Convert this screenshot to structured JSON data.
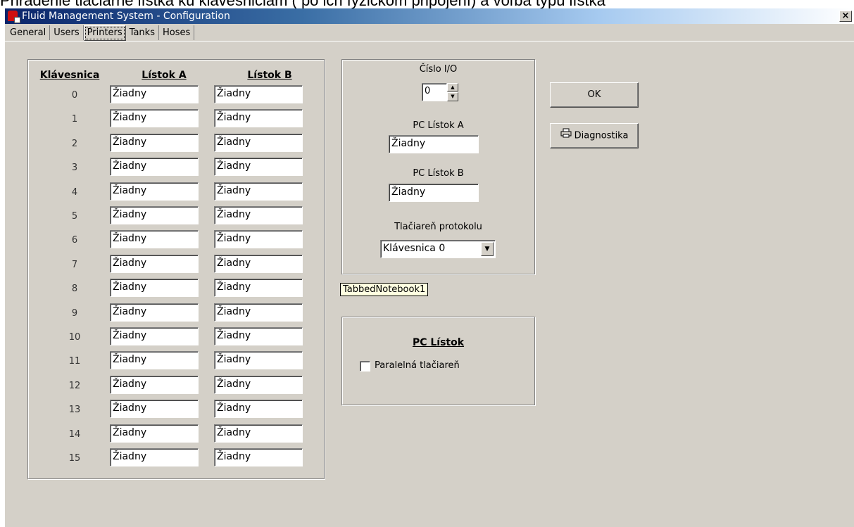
{
  "caption": "Priradenie tlačiarne lístka ku klávesniciam ( po ich fyzickom pripojení) a voľba typu lístka",
  "window": {
    "title": "Fluid Management System - Configuration",
    "close_glyph": "×"
  },
  "tabs": [
    "General",
    "Users",
    "Printers",
    "Tanks",
    "Hoses"
  ],
  "active_tab": "Printers",
  "grid": {
    "headers": {
      "keypad": "Klávesnica",
      "ticket_a": "Lístok A",
      "ticket_b": "Lístok B"
    },
    "rows": [
      {
        "num": "0",
        "a": "Žiadny",
        "b": "Žiadny"
      },
      {
        "num": "1",
        "a": "Žiadny",
        "b": "Žiadny"
      },
      {
        "num": "2",
        "a": "Žiadny",
        "b": "Žiadny"
      },
      {
        "num": "3",
        "a": "Žiadny",
        "b": "Žiadny"
      },
      {
        "num": "4",
        "a": "Žiadny",
        "b": "Žiadny"
      },
      {
        "num": "5",
        "a": "Žiadny",
        "b": "Žiadny"
      },
      {
        "num": "6",
        "a": "Žiadny",
        "b": "Žiadny"
      },
      {
        "num": "7",
        "a": "Žiadny",
        "b": "Žiadny"
      },
      {
        "num": "8",
        "a": "Žiadny",
        "b": "Žiadny"
      },
      {
        "num": "9",
        "a": "Žiadny",
        "b": "Žiadny"
      },
      {
        "num": "10",
        "a": "Žiadny",
        "b": "Žiadny"
      },
      {
        "num": "11",
        "a": "Žiadny",
        "b": "Žiadny"
      },
      {
        "num": "12",
        "a": "Žiadny",
        "b": "Žiadny"
      },
      {
        "num": "13",
        "a": "Žiadny",
        "b": "Žiadny"
      },
      {
        "num": "14",
        "a": "Žiadny",
        "b": "Žiadny"
      },
      {
        "num": "15",
        "a": "Žiadny",
        "b": "Žiadny"
      }
    ]
  },
  "pc_panel": {
    "io_label": "Číslo I/O",
    "io_value": "0",
    "pc_ticket_a_label": "PC Lístok A",
    "pc_ticket_a_value": "Žiadny",
    "pc_ticket_b_label": "PC Lístok B",
    "pc_ticket_b_value": "Žiadny",
    "protocol_printer_label": "Tlačiareň protokolu",
    "protocol_printer_value": "Klávesnica 0"
  },
  "tooltip": "TabbedNotebook1",
  "pc_ticket_group": {
    "title": "PC Lístok",
    "parallel_printer_label": "Paralelná tlačiareň",
    "parallel_printer_checked": false
  },
  "buttons": {
    "ok": "OK",
    "diagnostics": "Diagnostika",
    "diagnostics_icon": "printer-icon"
  }
}
